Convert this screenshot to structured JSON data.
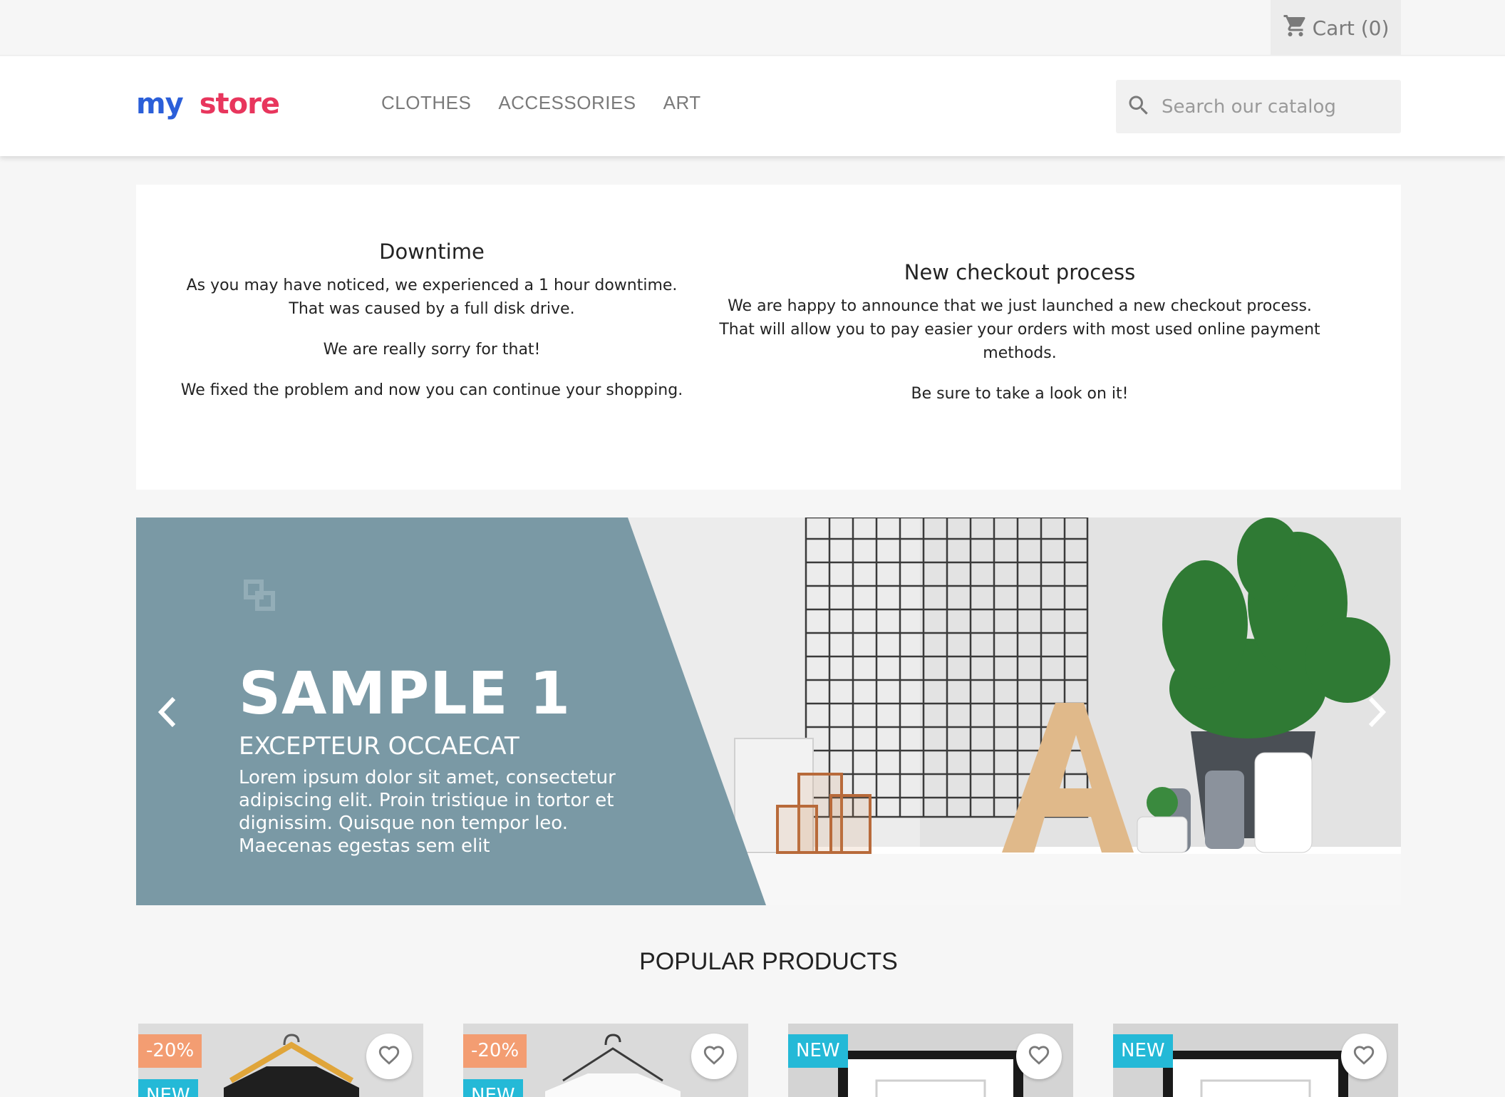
{
  "header": {
    "cart_label": "Cart (0)",
    "logo_part1": "my",
    "logo_part2": "store",
    "nav": [
      "CLOTHES",
      "ACCESSORIES",
      "ART"
    ],
    "search_placeholder": "Search our catalog"
  },
  "info": {
    "left": {
      "title": "Downtime",
      "p1_line1": "As you may have noticed, we experienced a 1 hour downtime.",
      "p1_line2": "That was caused by a full disk drive.",
      "p2": "We are really sorry for that!",
      "p3": "We fixed the problem and now you can continue your shopping."
    },
    "right": {
      "title": "New checkout process",
      "p1_line1": "We are happy to announce that we just launched a new checkout process.",
      "p1_line2": "That will allow you to pay easier your orders with most used online payment methods.",
      "p2": "Be sure to take a look on it!"
    }
  },
  "banner": {
    "title": "SAMPLE 1",
    "subtitle": "EXCEPTEUR OCCAECAT",
    "description": "Lorem ipsum dolor sit amet, consectetur adipiscing elit. Proin tristique in tortor et dignissim. Quisque non tempor leo. Maecenas egestas sem elit",
    "panel_color": "#7a99a5"
  },
  "products_section": {
    "title": "POPULAR PRODUCTS",
    "items": [
      {
        "discount": "-20%",
        "flag": "NEW",
        "image": "hanger-black-tshirt"
      },
      {
        "discount": "-20%",
        "flag": "NEW",
        "image": "hanger-white-tshirt"
      },
      {
        "flag": "NEW",
        "image": "framed-poster"
      },
      {
        "flag": "NEW",
        "image": "framed-poster"
      }
    ]
  },
  "colors": {
    "accent_new": "#24b9d7",
    "accent_discount": "#f39d72",
    "nav_text": "#7a7a7a"
  }
}
